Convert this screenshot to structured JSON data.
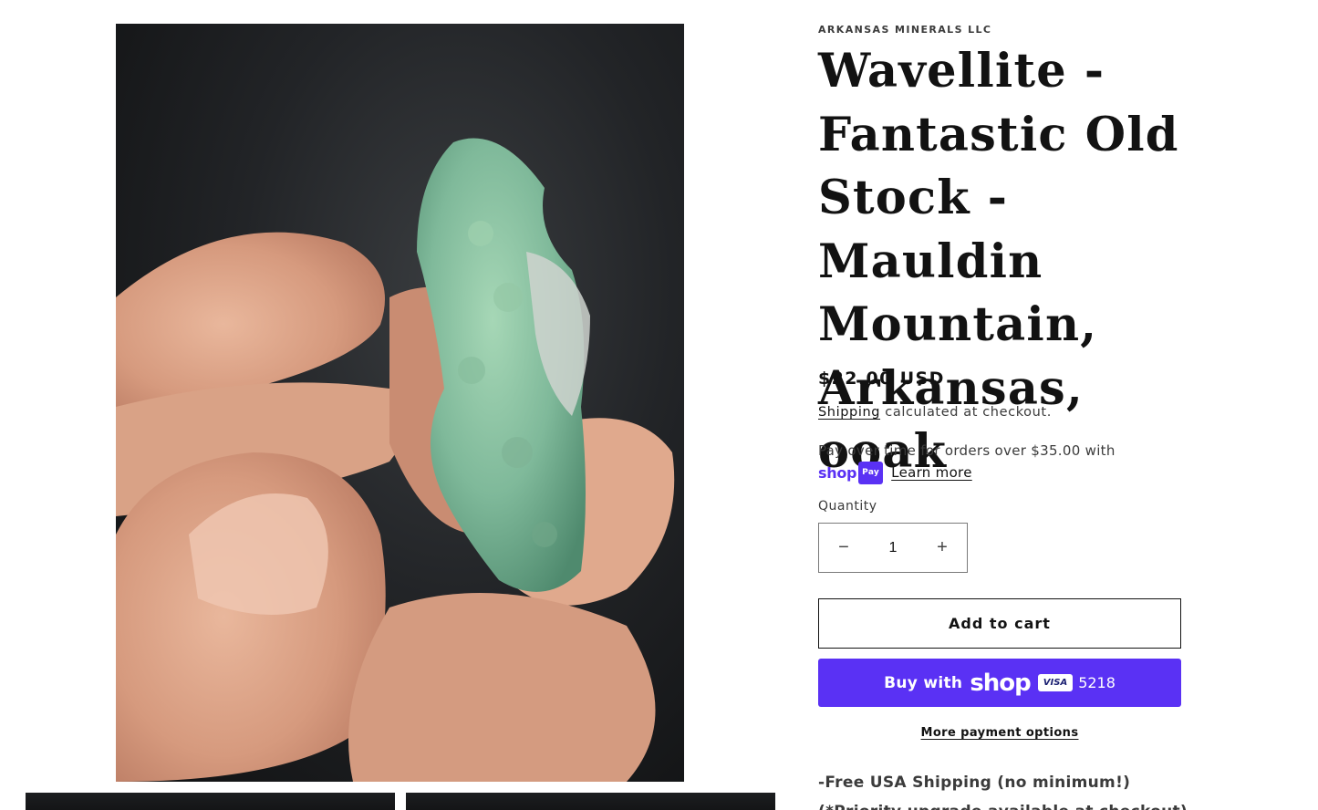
{
  "product": {
    "vendor": "ARKANSAS MINERALS LLC",
    "title": "Wavellite - Fantastic Old Stock - Mauldin Mountain, Arkansas, ooak",
    "price": "$22.00 USD",
    "shipping_link": "Shipping",
    "shipping_note": " calculated at checkout."
  },
  "installments": {
    "text": "Pay over time for orders over $35.00 with",
    "shop_word": "shop",
    "pay_chip": "Pay",
    "learn_more": "Learn more"
  },
  "quantity": {
    "label": "Quantity",
    "value": "1",
    "minus": "−",
    "plus": "+"
  },
  "actions": {
    "add_to_cart": "Add to cart",
    "buy_with": "Buy with",
    "shop_logo": "shop",
    "card_brand": "VISA",
    "card_last4": "5218",
    "more_payment": "More payment options"
  },
  "description": {
    "line1": "-Free USA Shipping (no minimum!)",
    "line2": "(*Priority upgrade available at checkout)"
  },
  "colors": {
    "shop_purple": "#5a31f4",
    "text_dark": "#121212",
    "text_muted": "#3b3b3b"
  }
}
